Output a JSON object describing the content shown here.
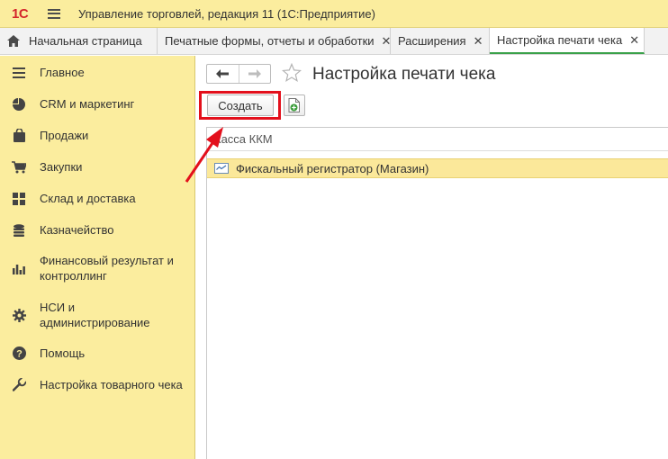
{
  "titlebar": {
    "logo": "1С",
    "app_title": "Управление торговлей, редакция 11  (1С:Предприятие)"
  },
  "tabs": [
    {
      "label": "Начальная страница",
      "icon": "home-icon",
      "closable": false,
      "active": false
    },
    {
      "label": "Печатные формы, отчеты и обработки",
      "closable": true,
      "active": false
    },
    {
      "label": "Расширения",
      "closable": true,
      "active": false
    },
    {
      "label": "Настройка печати чека",
      "closable": true,
      "active": true
    }
  ],
  "close_glyph": "✕",
  "sidebar": {
    "items": [
      {
        "label": "Главное",
        "icon": "menu-lines-icon"
      },
      {
        "label": "CRM и маркетинг",
        "icon": "pie-chart-icon"
      },
      {
        "label": "Продажи",
        "icon": "shopping-bag-icon"
      },
      {
        "label": "Закупки",
        "icon": "cart-icon"
      },
      {
        "label": "Склад и доставка",
        "icon": "grid-icon"
      },
      {
        "label": "Казначейство",
        "icon": "coins-icon"
      },
      {
        "label": "Финансовый результат и контроллинг",
        "icon": "bar-chart-icon"
      },
      {
        "label": "НСИ и администрирование",
        "icon": "gear-icon"
      },
      {
        "label": "Помощь",
        "icon": "help-icon"
      },
      {
        "label": "Настройка товарного чека",
        "icon": "wrench-icon"
      }
    ]
  },
  "form": {
    "title": "Настройка печати чека",
    "create_label": "Создать",
    "list": {
      "column_header": "Касса ККМ",
      "rows": [
        {
          "label": "Фискальный регистратор (Магазин)",
          "icon": "fiscal-register-icon"
        }
      ]
    }
  },
  "colors": {
    "sidebar_bg": "#fbed9e",
    "highlight": "#e3101c",
    "active_tab_underline": "#3aa14a",
    "selected_row": "#fbe89a"
  }
}
